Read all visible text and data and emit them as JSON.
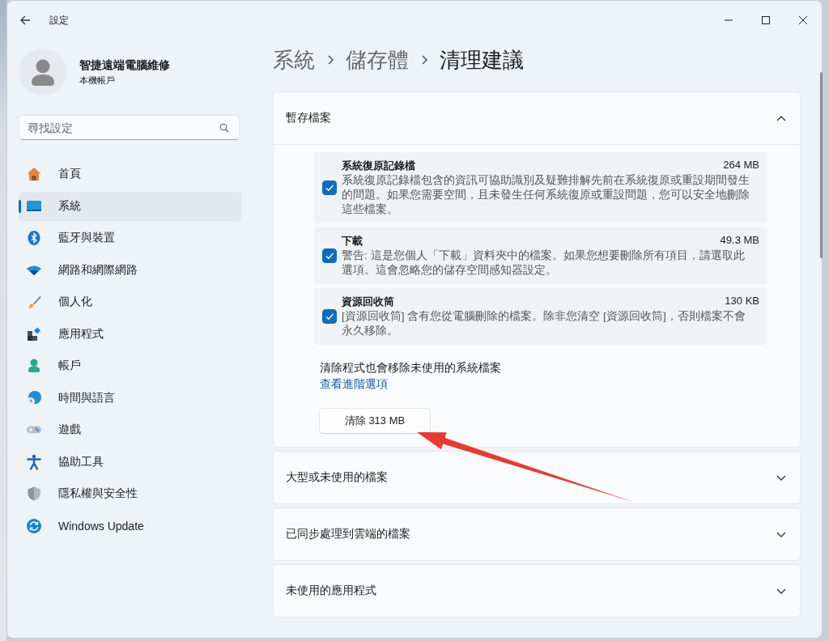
{
  "window": {
    "title": "設定"
  },
  "account": {
    "name": "智捷遠端電腦維修",
    "type": "本機帳戶"
  },
  "search": {
    "placeholder": "尋找設定"
  },
  "nav": [
    {
      "label": "首頁",
      "kind": "home",
      "selected": false
    },
    {
      "label": "系統",
      "kind": "system",
      "selected": true
    },
    {
      "label": "藍牙與裝置",
      "kind": "bluetooth",
      "selected": false
    },
    {
      "label": "網路和網際網路",
      "kind": "network",
      "selected": false
    },
    {
      "label": "個人化",
      "kind": "brush",
      "selected": false
    },
    {
      "label": "應用程式",
      "kind": "apps",
      "selected": false
    },
    {
      "label": "帳戶",
      "kind": "person",
      "selected": false
    },
    {
      "label": "時間與語言",
      "kind": "globe",
      "selected": false
    },
    {
      "label": "遊戲",
      "kind": "gamepad",
      "selected": false
    },
    {
      "label": "協助工具",
      "kind": "accessibility",
      "selected": false
    },
    {
      "label": "隱私權與安全性",
      "kind": "shield",
      "selected": false
    },
    {
      "label": "Windows Update",
      "kind": "update",
      "selected": false
    }
  ],
  "breadcrumb": [
    "系統",
    "儲存體",
    "清理建議"
  ],
  "sections": [
    {
      "title": "暫存檔案",
      "expanded": true,
      "items": [
        {
          "title": "系統復原記錄檔",
          "size": "264 MB",
          "description": "系統復原記錄檔包含的資訊可協助識別及疑難排解先前在系統復原或重設期間發生的問題。如果您需要空間，且未發生任何系統復原或重設問題，您可以安全地刪除這些檔案。",
          "checked": true
        },
        {
          "title": "下載",
          "size": "49.3 MB",
          "description": "警告: 這是您個人「下載」資料夾中的檔案。如果您想要刪除所有項目，請選取此選項。這會忽略您的儲存空間感知器設定。",
          "checked": true
        },
        {
          "title": "資源回收筒",
          "size": "130 KB",
          "description": "[資源回收筒] 含有您從電腦刪除的檔案。除非您清空 [資源回收筒]，否則檔案不會永久移除。",
          "checked": true
        }
      ],
      "note": "清除程式也會移除未使用的系統檔案",
      "link": "查看進階選項",
      "button": "清除 313 MB"
    },
    {
      "title": "大型或未使用的檔案",
      "expanded": false
    },
    {
      "title": "已同步處理到雲端的檔案",
      "expanded": false
    },
    {
      "title": "未使用的應用程式",
      "expanded": false
    }
  ]
}
